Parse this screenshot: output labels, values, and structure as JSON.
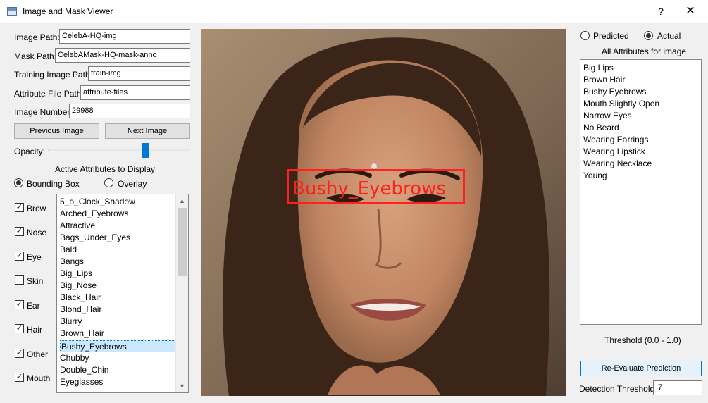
{
  "window": {
    "title": "Image and Mask Viewer",
    "help": "?",
    "close": "✕"
  },
  "paths": {
    "image_path_label": "Image Path:",
    "image_path_value": "CelebA-HQ-img",
    "mask_path_label": "Mask Path:",
    "mask_path_value": "CelebAMask-HQ-mask-anno",
    "training_path_label": "Training Image Path:",
    "training_path_value": "train-img",
    "attribute_path_label": "Attribute File Path:",
    "attribute_path_value": "attribute-files",
    "image_number_label": "Image Number:",
    "image_number_value": "29988"
  },
  "nav": {
    "previous": "Previous Image",
    "next": "Next Image"
  },
  "opacity": {
    "label": "Opacity:",
    "level": 0.65
  },
  "display": {
    "heading": "Active Attributes to Display",
    "bounding_box": "Bounding Box",
    "overlay": "Overlay",
    "selected": "Bounding Box"
  },
  "checkboxes": [
    {
      "label": "Brow",
      "checked": true
    },
    {
      "label": "Nose",
      "checked": true
    },
    {
      "label": "Eye",
      "checked": true
    },
    {
      "label": "Skin",
      "checked": false
    },
    {
      "label": "Ear",
      "checked": true
    },
    {
      "label": "Hair",
      "checked": true
    },
    {
      "label": "Other",
      "checked": true
    },
    {
      "label": "Mouth",
      "checked": true
    }
  ],
  "attribute_list": [
    "5_o_Clock_Shadow",
    "Arched_Eyebrows",
    "Attractive",
    "Bags_Under_Eyes",
    "Bald",
    "Bangs",
    "Big_Lips",
    "Big_Nose",
    "Black_Hair",
    "Blond_Hair",
    "Blurry",
    "Brown_Hair",
    "Bushy_Eyebrows",
    "Chubby",
    "Double_Chin",
    "Eyeglasses"
  ],
  "attribute_list_selected": "Bushy_Eyebrows",
  "image": {
    "box_label": "Bushy_Eyebrows",
    "box_color": "#ff2020"
  },
  "prediction": {
    "predicted": "Predicted",
    "actual": "Actual",
    "selected": "Actual",
    "heading": "All Attributes for image",
    "attributes": [
      "Big Lips",
      "Brown Hair",
      "Bushy Eyebrows",
      "Mouth Slightly Open",
      "Narrow Eyes",
      "No Beard",
      "Wearing Earrings",
      "Wearing Lipstick",
      "Wearing Necklace",
      "Young"
    ]
  },
  "threshold": {
    "range_label": "Threshold (0.0 - 1.0)",
    "reevaluate": "Re-Evaluate Prediction",
    "detection_label": "Detection Threshold",
    "detection_value": ".7"
  },
  "colors": {
    "accent": "#0078d7",
    "selection": "#cce8ff",
    "box": "#ff2020"
  }
}
